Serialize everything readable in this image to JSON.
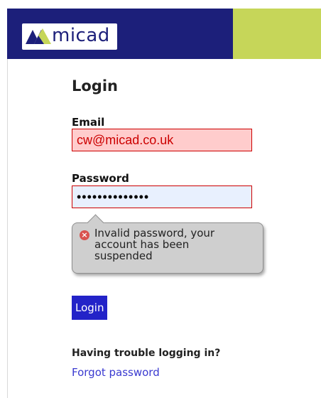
{
  "header": {
    "logo_text": "micad",
    "brand_navy": "#1c1f7a",
    "brand_green": "#c6d659"
  },
  "login": {
    "title": "Login",
    "email_label": "Email",
    "email_value": "cw@micad.co.uk",
    "password_label": "Password",
    "password_value": "••••••••••••••",
    "error_icon": "error-x-icon",
    "error_message": "Invalid password, your\naccount has been\nsuspended",
    "submit_label": "Login",
    "error_color": "#cc0000",
    "button_color": "#2323c8"
  },
  "help": {
    "heading": "Having trouble logging in?",
    "forgot_link": "Forgot password"
  }
}
